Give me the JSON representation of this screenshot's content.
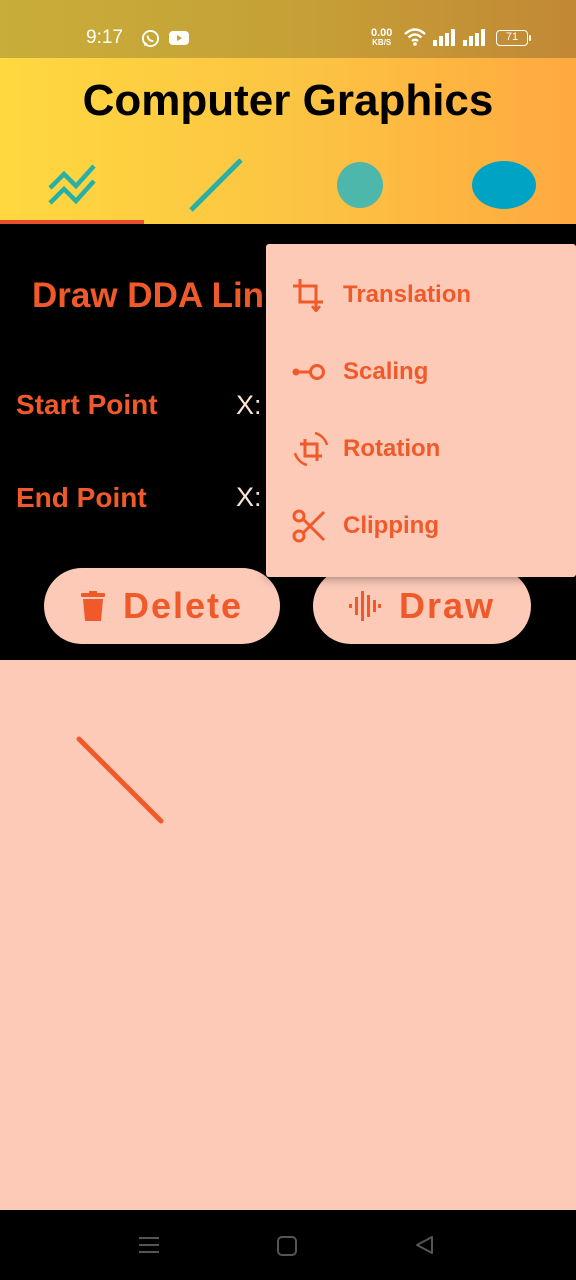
{
  "status": {
    "time": "9:17",
    "speed_value": "0.00",
    "speed_unit": "KB/S",
    "battery": "71",
    "icons": [
      "whatsapp-icon",
      "youtube-icon",
      "wifi-icon",
      "signal-icon",
      "signal-icon",
      "battery-icon"
    ]
  },
  "app": {
    "title": "Computer Graphics"
  },
  "tabs": [
    {
      "name": "polyline-icon",
      "selected": true
    },
    {
      "name": "line-icon",
      "selected": false
    },
    {
      "name": "circle-icon",
      "selected": false
    },
    {
      "name": "ellipse-icon",
      "selected": false
    }
  ],
  "form": {
    "heading": "Draw DDA Lin",
    "start_label": "Start Point",
    "end_label": "End Point",
    "x_label": "X:"
  },
  "buttons": {
    "delete": "Delete",
    "draw": "Draw"
  },
  "menu": {
    "items": [
      {
        "label": "Translation",
        "icon": "crop-icon"
      },
      {
        "label": "Scaling",
        "icon": "scale-icon"
      },
      {
        "label": "Rotation",
        "icon": "rotate-icon"
      },
      {
        "label": "Clipping",
        "icon": "scissors-icon"
      }
    ]
  },
  "colors": {
    "accent": "#f05a2a",
    "teal": "#26b0a6",
    "canvas_bg": "#fdcab8"
  }
}
